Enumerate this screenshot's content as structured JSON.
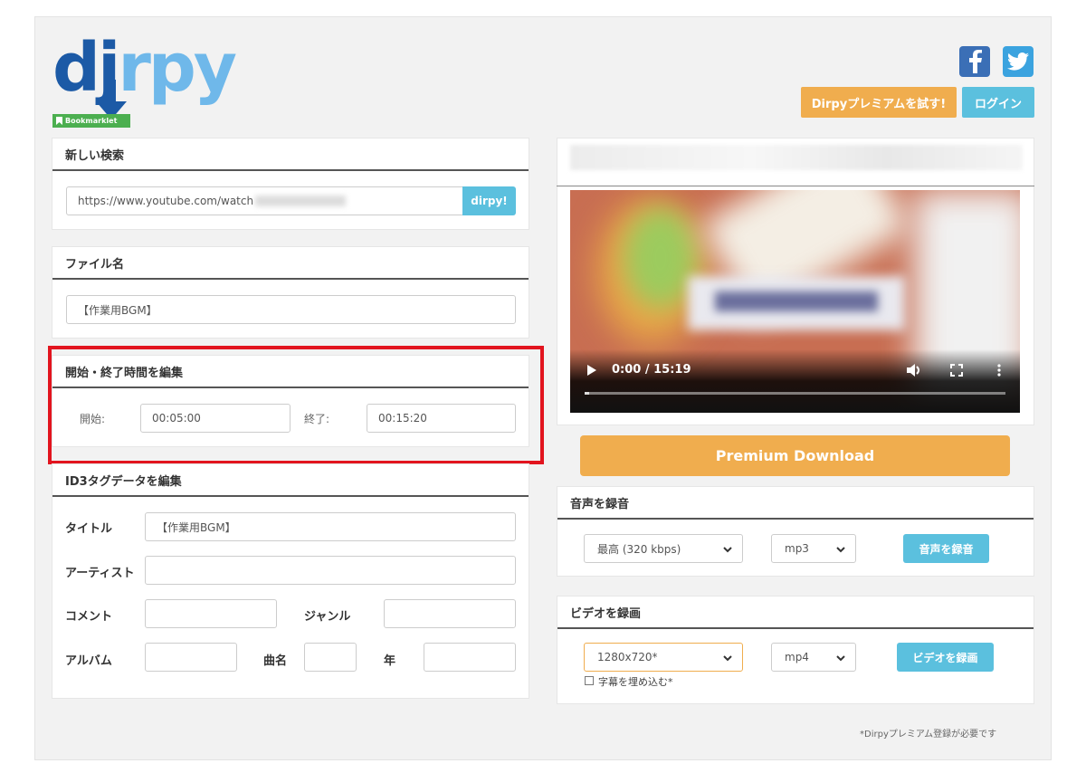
{
  "logo": {
    "part1": "dj",
    "part2": "rpy",
    "badge": "Bookmarklet"
  },
  "header": {
    "premium_try": "Dirpyプレミアムを試す!",
    "login": "ログイン"
  },
  "search": {
    "title": "新しい検索",
    "url": "https://www.youtube.com/watch",
    "button": "dirpy!"
  },
  "filename": {
    "title": "ファイル名",
    "value": "【作業用BGM】"
  },
  "trim": {
    "title": "開始・終了時間を編集",
    "start_label": "開始:",
    "start_value": "00:05:00",
    "end_label": "終了:",
    "end_value": "00:15:20"
  },
  "id3": {
    "title": "ID3タグデータを編集",
    "title_label": "タイトル",
    "title_value": "【作業用BGM】",
    "artist_label": "アーティスト",
    "comment_label": "コメント",
    "genre_label": "ジャンル",
    "album_label": "アルバム",
    "track_label": "曲名",
    "year_label": "年"
  },
  "video": {
    "time": "0:00 / 15:19",
    "progress": 0.01
  },
  "premium_download": "Premium Download",
  "audio": {
    "title": "音声を録音",
    "quality": "最高 (320 kbps)",
    "format": "mp3",
    "button": "音声を録音"
  },
  "videorec": {
    "title": "ビデオを録画",
    "resolution": "1280x720*",
    "format": "mp4",
    "button": "ビデオを録画",
    "subtitle_label": "字幕を埋め込む*"
  },
  "footnote": "*Dirpyプレミアム登録が必要です",
  "colors": {
    "accent_orange": "#f0ad4e",
    "accent_blue": "#5bc0de",
    "highlight_red": "#e2141e"
  }
}
